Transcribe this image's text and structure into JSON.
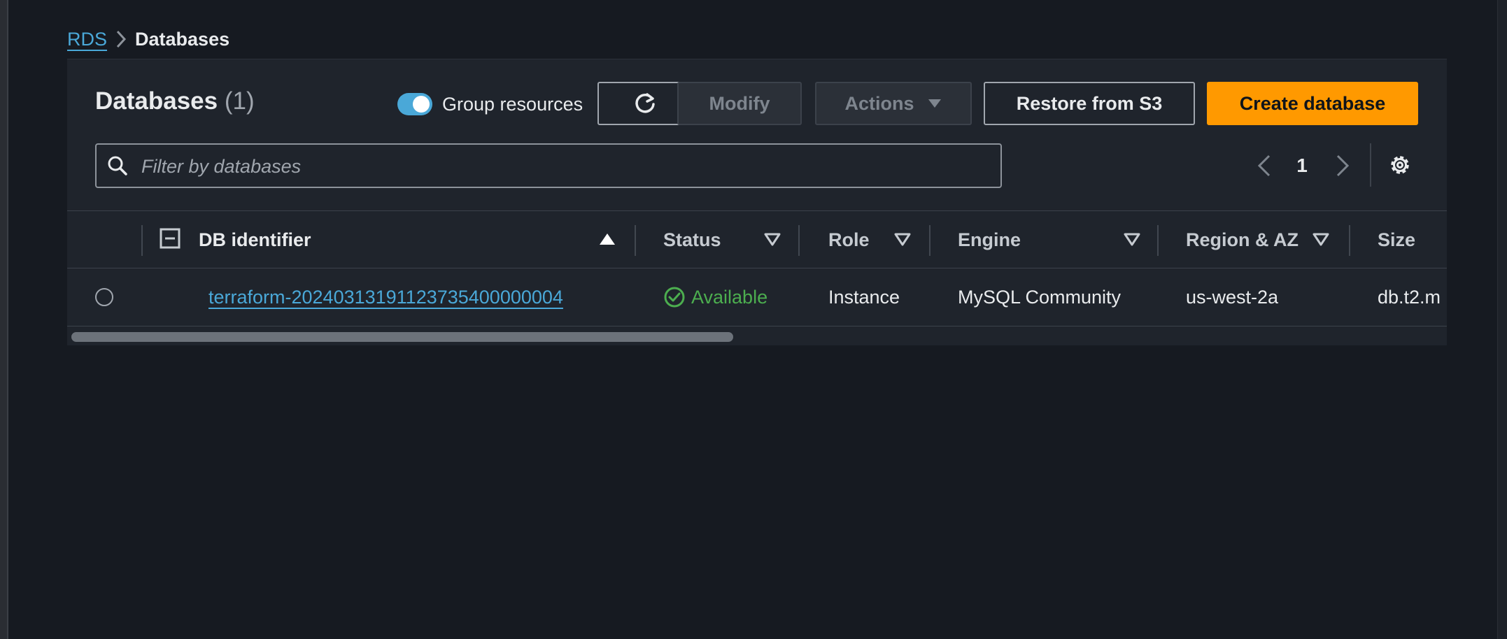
{
  "breadcrumb": {
    "root": "RDS",
    "current": "Databases"
  },
  "panel": {
    "title": "Databases",
    "count": "(1)",
    "group_toggle": {
      "label": "Group resources",
      "on": true
    },
    "buttons": {
      "modify": "Modify",
      "actions": "Actions",
      "restore": "Restore from S3",
      "create": "Create database"
    },
    "filter": {
      "placeholder": "Filter by databases",
      "value": ""
    },
    "pagination": {
      "page": "1"
    }
  },
  "table": {
    "headers": {
      "db_identifier": "DB identifier",
      "status": "Status",
      "role": "Role",
      "engine": "Engine",
      "region": "Region & AZ",
      "size": "Size"
    },
    "rows": [
      {
        "db_identifier": "terraform-20240313191123735400000004",
        "status": "Available",
        "role": "Instance",
        "engine": "MySQL Community",
        "region": "us-west-2a",
        "size": "db.t2.m"
      }
    ]
  },
  "colors": {
    "accent": "#4aa8d8",
    "primary_button": "#ff9900",
    "status_available": "#4cae4f",
    "background": "#161a21",
    "panel": "#1f242c"
  }
}
